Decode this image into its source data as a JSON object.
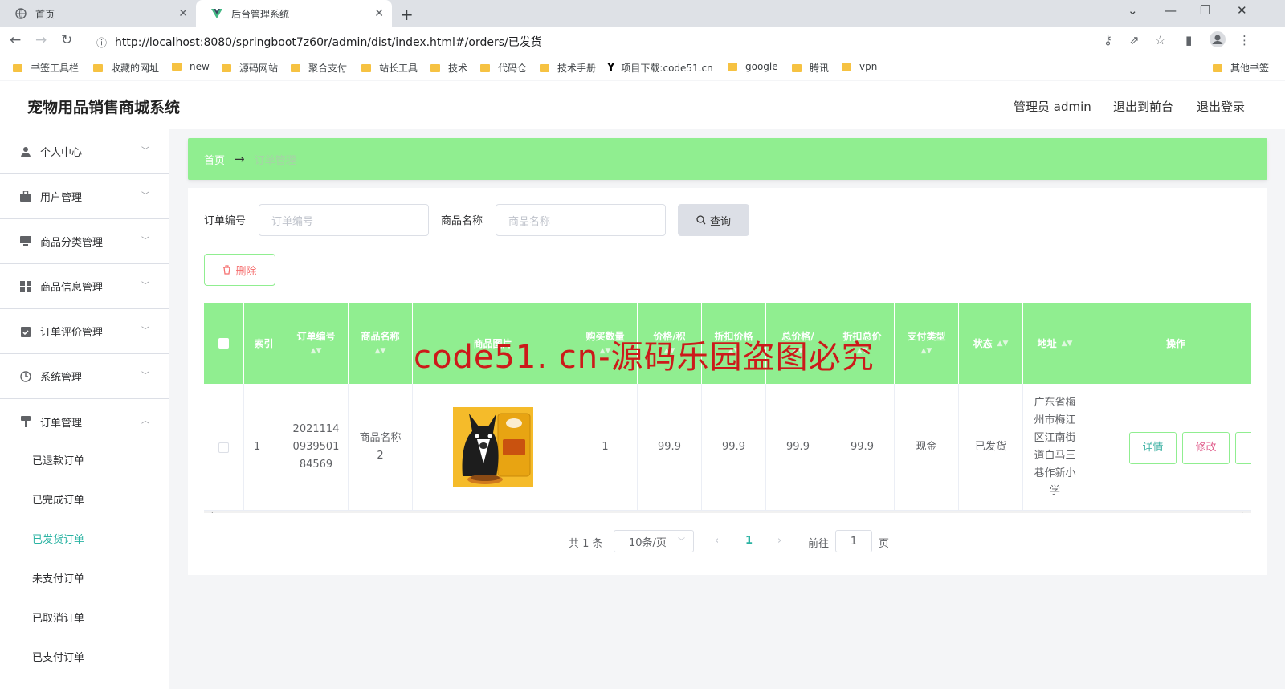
{
  "browser": {
    "tabs": [
      {
        "title": "首页",
        "icon": "globe-icon"
      },
      {
        "title": "后台管理系统",
        "icon": "vue-icon",
        "active": true
      }
    ],
    "url": "http://localhost:8080/springboot7z60r/admin/dist/index.html#/orders/已发货",
    "bookmarks": [
      "书签工具栏",
      "收藏的网址",
      "new",
      "源码网站",
      "聚合支付",
      "站长工具",
      "技术",
      "代码仓",
      "技术手册",
      "项目下载:code51.cn",
      "google",
      "腾讯",
      "vpn",
      "其他书签"
    ]
  },
  "header": {
    "title": "宠物用品销售商城系统",
    "user": "管理员 admin",
    "to_front": "退出到前台",
    "logout": "退出登录"
  },
  "sidebar": {
    "items": [
      {
        "label": "个人中心",
        "icon": "user-icon"
      },
      {
        "label": "用户管理",
        "icon": "briefcase-icon"
      },
      {
        "label": "商品分类管理",
        "icon": "monitor-icon"
      },
      {
        "label": "商品信息管理",
        "icon": "grid-icon"
      },
      {
        "label": "订单评价管理",
        "icon": "checklist-icon"
      },
      {
        "label": "系统管理",
        "icon": "clock-icon"
      },
      {
        "label": "订单管理",
        "icon": "pin-icon",
        "expanded": true
      }
    ],
    "subitems": [
      "已退款订单",
      "已完成订单",
      "已发货订单",
      "未支付订单",
      "已取消订单",
      "已支付订单"
    ],
    "active_subitem": "已发货订单"
  },
  "breadcrumb": {
    "home": "首页",
    "separator": "→",
    "current": "订单管理"
  },
  "search": {
    "order_no_label": "订单编号",
    "order_no_placeholder": "订单编号",
    "product_name_label": "商品名称",
    "product_name_placeholder": "商品名称",
    "query_button": "查询",
    "delete_button": "删除"
  },
  "table": {
    "columns": [
      "索引",
      "订单编号",
      "商品名称",
      "商品图片",
      "购买数量",
      "价格/积",
      "折扣价格",
      "总价格/",
      "折扣总价",
      "支付类型",
      "状态",
      "地址",
      "操作"
    ],
    "rows": [
      {
        "index": "1",
        "order_no": "20211140939501 84569",
        "order_no_lines": [
          "2021114",
          "0939501",
          "84569"
        ],
        "product_name_lines": [
          "商品名称",
          "2"
        ],
        "product_image": "pet-food-bag-with-dog",
        "quantity": "1",
        "price": "99.9",
        "discount_price": "99.9",
        "total_price": "99.9",
        "discount_total": "99.9",
        "pay_type": "现金",
        "status": "已发货",
        "address_lines": [
          "广东省梅",
          "州市梅江",
          "区江南街",
          "道白马三",
          "巷作新小",
          "学"
        ]
      }
    ],
    "actions": {
      "detail": "详情",
      "edit": "修改"
    }
  },
  "pagination": {
    "total": "共 1 条",
    "page_size": "10条/页",
    "current_page": "1",
    "goto_label": "前往",
    "goto_value": "1",
    "page_unit": "页"
  },
  "watermark": "code51. cn-源码乐园盗图必究",
  "colors": {
    "accent_green": "#90ee90",
    "active_text": "#2bb3a3",
    "danger": "#f56c6c",
    "edit_pink": "#e05a8a",
    "detail_teal": "#46b5a8",
    "watermark_red": "#cc1a1a"
  }
}
